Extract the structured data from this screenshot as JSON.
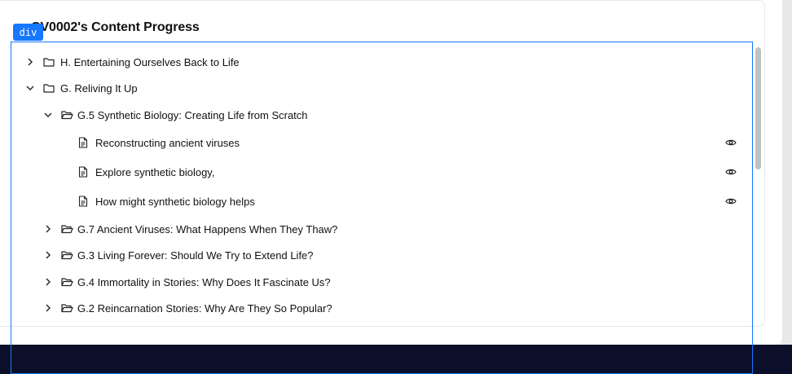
{
  "header": {
    "title": "CV0002's Content Progress"
  },
  "inspector": {
    "tag": "div"
  },
  "tree": [
    {
      "label": "H. Entertaining Ourselves Back to Life",
      "level": 0,
      "kind": "folder",
      "expanded": false
    },
    {
      "label": "G. Reliving It Up",
      "level": 0,
      "kind": "folder",
      "expanded": true
    },
    {
      "label": "G.5 Synthetic Biology: Creating Life from Scratch",
      "level": 1,
      "kind": "folder-open",
      "expanded": true
    },
    {
      "label": "Reconstructing ancient viruses",
      "level": 2,
      "kind": "doc",
      "action_icon": "eye-icon"
    },
    {
      "label": "Explore synthetic biology,",
      "level": 2,
      "kind": "doc",
      "action_icon": "eye-icon"
    },
    {
      "label": "How might synthetic biology helps",
      "level": 2,
      "kind": "doc",
      "action_icon": "eye-icon"
    },
    {
      "label": "G.7 Ancient Viruses: What Happens When They Thaw?",
      "level": 1,
      "kind": "folder-open",
      "expanded": false
    },
    {
      "label": "G.3 Living Forever: Should We Try to Extend Life?",
      "level": 1,
      "kind": "folder-open",
      "expanded": false
    },
    {
      "label": "G.4 Immortality in Stories: Why Does It Fascinate Us?",
      "level": 1,
      "kind": "folder-open",
      "expanded": false
    },
    {
      "label": "G.2 Reincarnation Stories: Why Are They So Popular?",
      "level": 1,
      "kind": "folder-open",
      "expanded": false
    }
  ]
}
